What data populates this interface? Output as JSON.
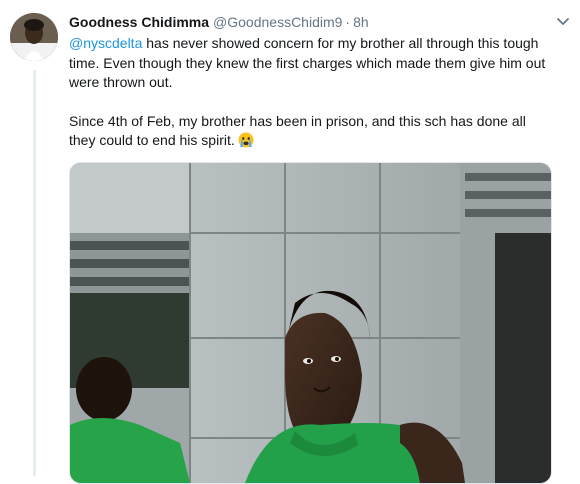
{
  "tweet": {
    "display_name": "Goodness Chidimma",
    "handle": "@GoodnessChidim9",
    "separator": "·",
    "timestamp": "8h",
    "mention": "@nyscdelta",
    "text_part1": " has never showed concern for my brother all through this tough time. Even though they knew the first charges which made them give him out were thrown out.",
    "text_part2": "Since 4th of Feb, my brother has been in prison, and this sch has done all they could to end his spirit.",
    "emoji": "crying-face-emoji"
  },
  "icons": {
    "more_menu": "chevron-down-icon",
    "avatar": "user-avatar"
  },
  "colors": {
    "accent": "#1b95e0",
    "text": "#14171a",
    "secondary": "#657786",
    "thread_line": "#e6ecf0",
    "shirt_green": "#23a04a"
  }
}
